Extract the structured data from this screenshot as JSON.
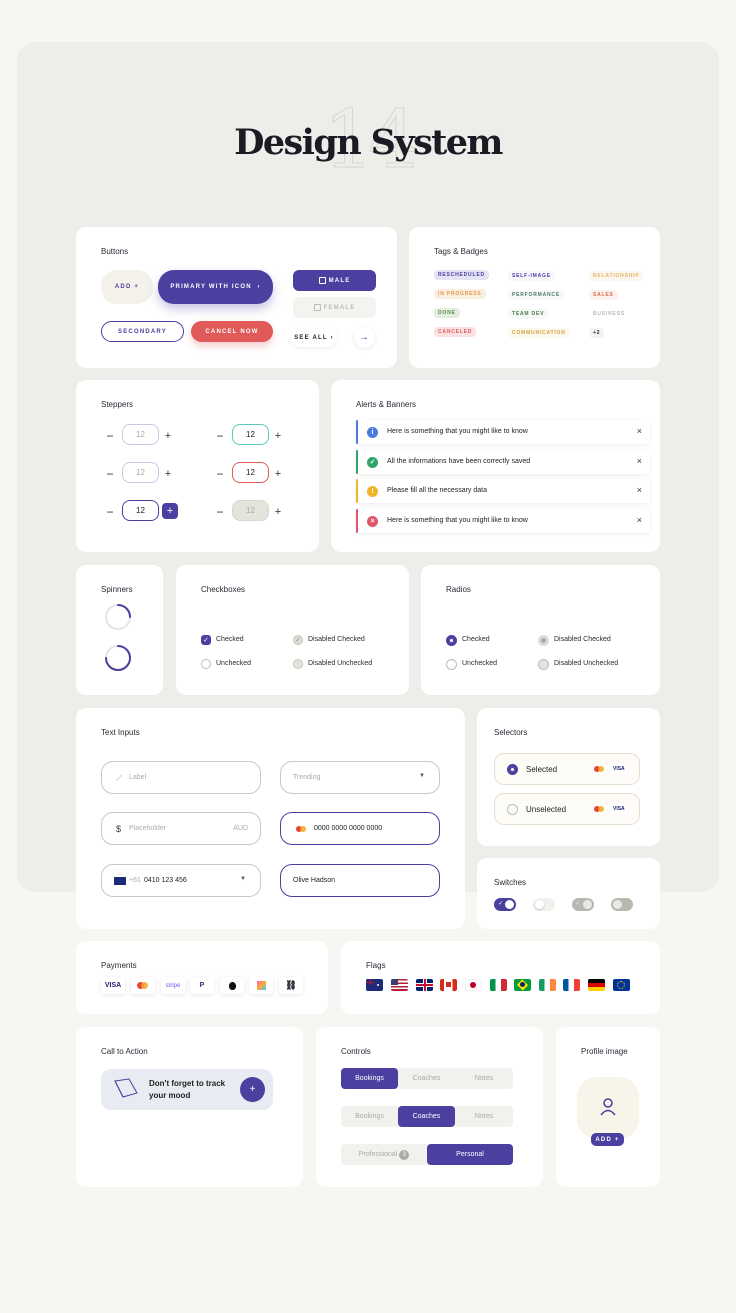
{
  "hero": {
    "number": "14",
    "title": "Design System"
  },
  "buttons": {
    "title": "Buttons",
    "add": "ADD",
    "primary": "PRIMARY WITH ICON",
    "male": "MALE",
    "female": "FEMALE",
    "secondary": "SECONDARY",
    "cancel": "CANCEL NOW",
    "see_all": "SEE ALL"
  },
  "tags": {
    "title": "Tags & Badges",
    "items": [
      {
        "text": "RESCHEDULED",
        "color": "#4b3fa0",
        "bg": "#e4e2f5"
      },
      {
        "text": "IN PROGRESS",
        "color": "#e39a4a",
        "bg": "#fbeee0"
      },
      {
        "text": "DONE",
        "color": "#5a8a52",
        "bg": "#e4eede"
      },
      {
        "text": "CANCELED",
        "color": "#d85c5c",
        "bg": "#fbe1e1"
      },
      {
        "text": "SELF-IMAGE",
        "color": "#4b3fa0",
        "bg": "#f7f7fb"
      },
      {
        "text": "PERFORMANCE",
        "color": "#4a7a6a",
        "bg": "#f6f8f7"
      },
      {
        "text": "TEAM DEV",
        "color": "#4a7a4a",
        "bg": "#f6f8f6"
      },
      {
        "text": "COMMUNICATION",
        "color": "#d9a23a",
        "bg": "#fbf8f0"
      },
      {
        "text": "RELATIONSHIP",
        "color": "#e8b26a",
        "bg": "#fbf6ee"
      },
      {
        "text": "SALES",
        "color": "#e06a4a",
        "bg": "#fbf2ef"
      },
      {
        "text": "BUSINESS",
        "color": "#b8b8b8",
        "bg": "#ffffff"
      },
      {
        "text": "+2",
        "color": "#222",
        "bg": "#f3f3f3"
      }
    ]
  },
  "steppers": {
    "title": "Steppers",
    "value": "12",
    "minus": "−",
    "plus": "+"
  },
  "alerts": {
    "title": "Alerts & Banners",
    "items": [
      {
        "text": "Here is something that you might like to know",
        "color": "#4a7cd9",
        "icon": "i"
      },
      {
        "text": "All the informations have been correctly saved",
        "color": "#2ea36a",
        "icon": "✓"
      },
      {
        "text": "Please fill all the necessary data",
        "color": "#f0b429",
        "icon": "!"
      },
      {
        "text": "Here is something that you might like to know",
        "color": "#e0566a",
        "icon": "×"
      }
    ],
    "close": "×"
  },
  "spinners": {
    "title": "Spinners"
  },
  "checkboxes": {
    "title": "Checkboxes",
    "checked": "Checked",
    "unchecked": "Unchecked",
    "disabled_checked": "Disabled Checked",
    "disabled_unchecked": "Disabled Unchecked"
  },
  "radios": {
    "title": "Radios",
    "checked": "Checked",
    "unchecked": "Unchecked",
    "disabled_checked": "Disabled Checked",
    "disabled_unchecked": "Disabled Unchecked"
  },
  "inputs": {
    "title": "Text Inputs",
    "label": "Label",
    "trending": "Trending",
    "currency": "$",
    "placeholder": "Placeholder",
    "aud": "AUD",
    "card": "0000 0000 0000 0000",
    "prefix": "+61",
    "phone": "0410 123 456",
    "name": "Olive Hadson"
  },
  "selectors": {
    "title": "Selectors",
    "selected": "Selected",
    "unselected": "Unselected",
    "visa": "VISA"
  },
  "switches": {
    "title": "Switches"
  },
  "payments": {
    "title": "Payments",
    "items": [
      "VISA",
      "mastercard",
      "stripe",
      "paypal",
      "apple",
      "klarna",
      "link"
    ],
    "visa": "VISA",
    "stripe": "stripe",
    "paypal": "P"
  },
  "flags": {
    "title": "Flags",
    "items": [
      "au",
      "us",
      "gb",
      "ca",
      "jp",
      "it",
      "br",
      "ie",
      "fr",
      "de",
      "eu"
    ]
  },
  "cta": {
    "title": "Call to Action",
    "text": "Don't forget to track your mood",
    "button": "+"
  },
  "controls": {
    "title": "Controls",
    "row1": [
      "Bookings",
      "Coaches",
      "Notes"
    ],
    "row2": [
      "Bookings",
      "Coaches",
      "Notes"
    ],
    "row3": [
      "Professional",
      "Personal"
    ],
    "badge": "3"
  },
  "profile": {
    "title": "Profile image",
    "add": "ADD"
  },
  "colors": {
    "primary": "#4b3fa0",
    "danger": "#e05a5a",
    "teal": "#58c9b8"
  }
}
